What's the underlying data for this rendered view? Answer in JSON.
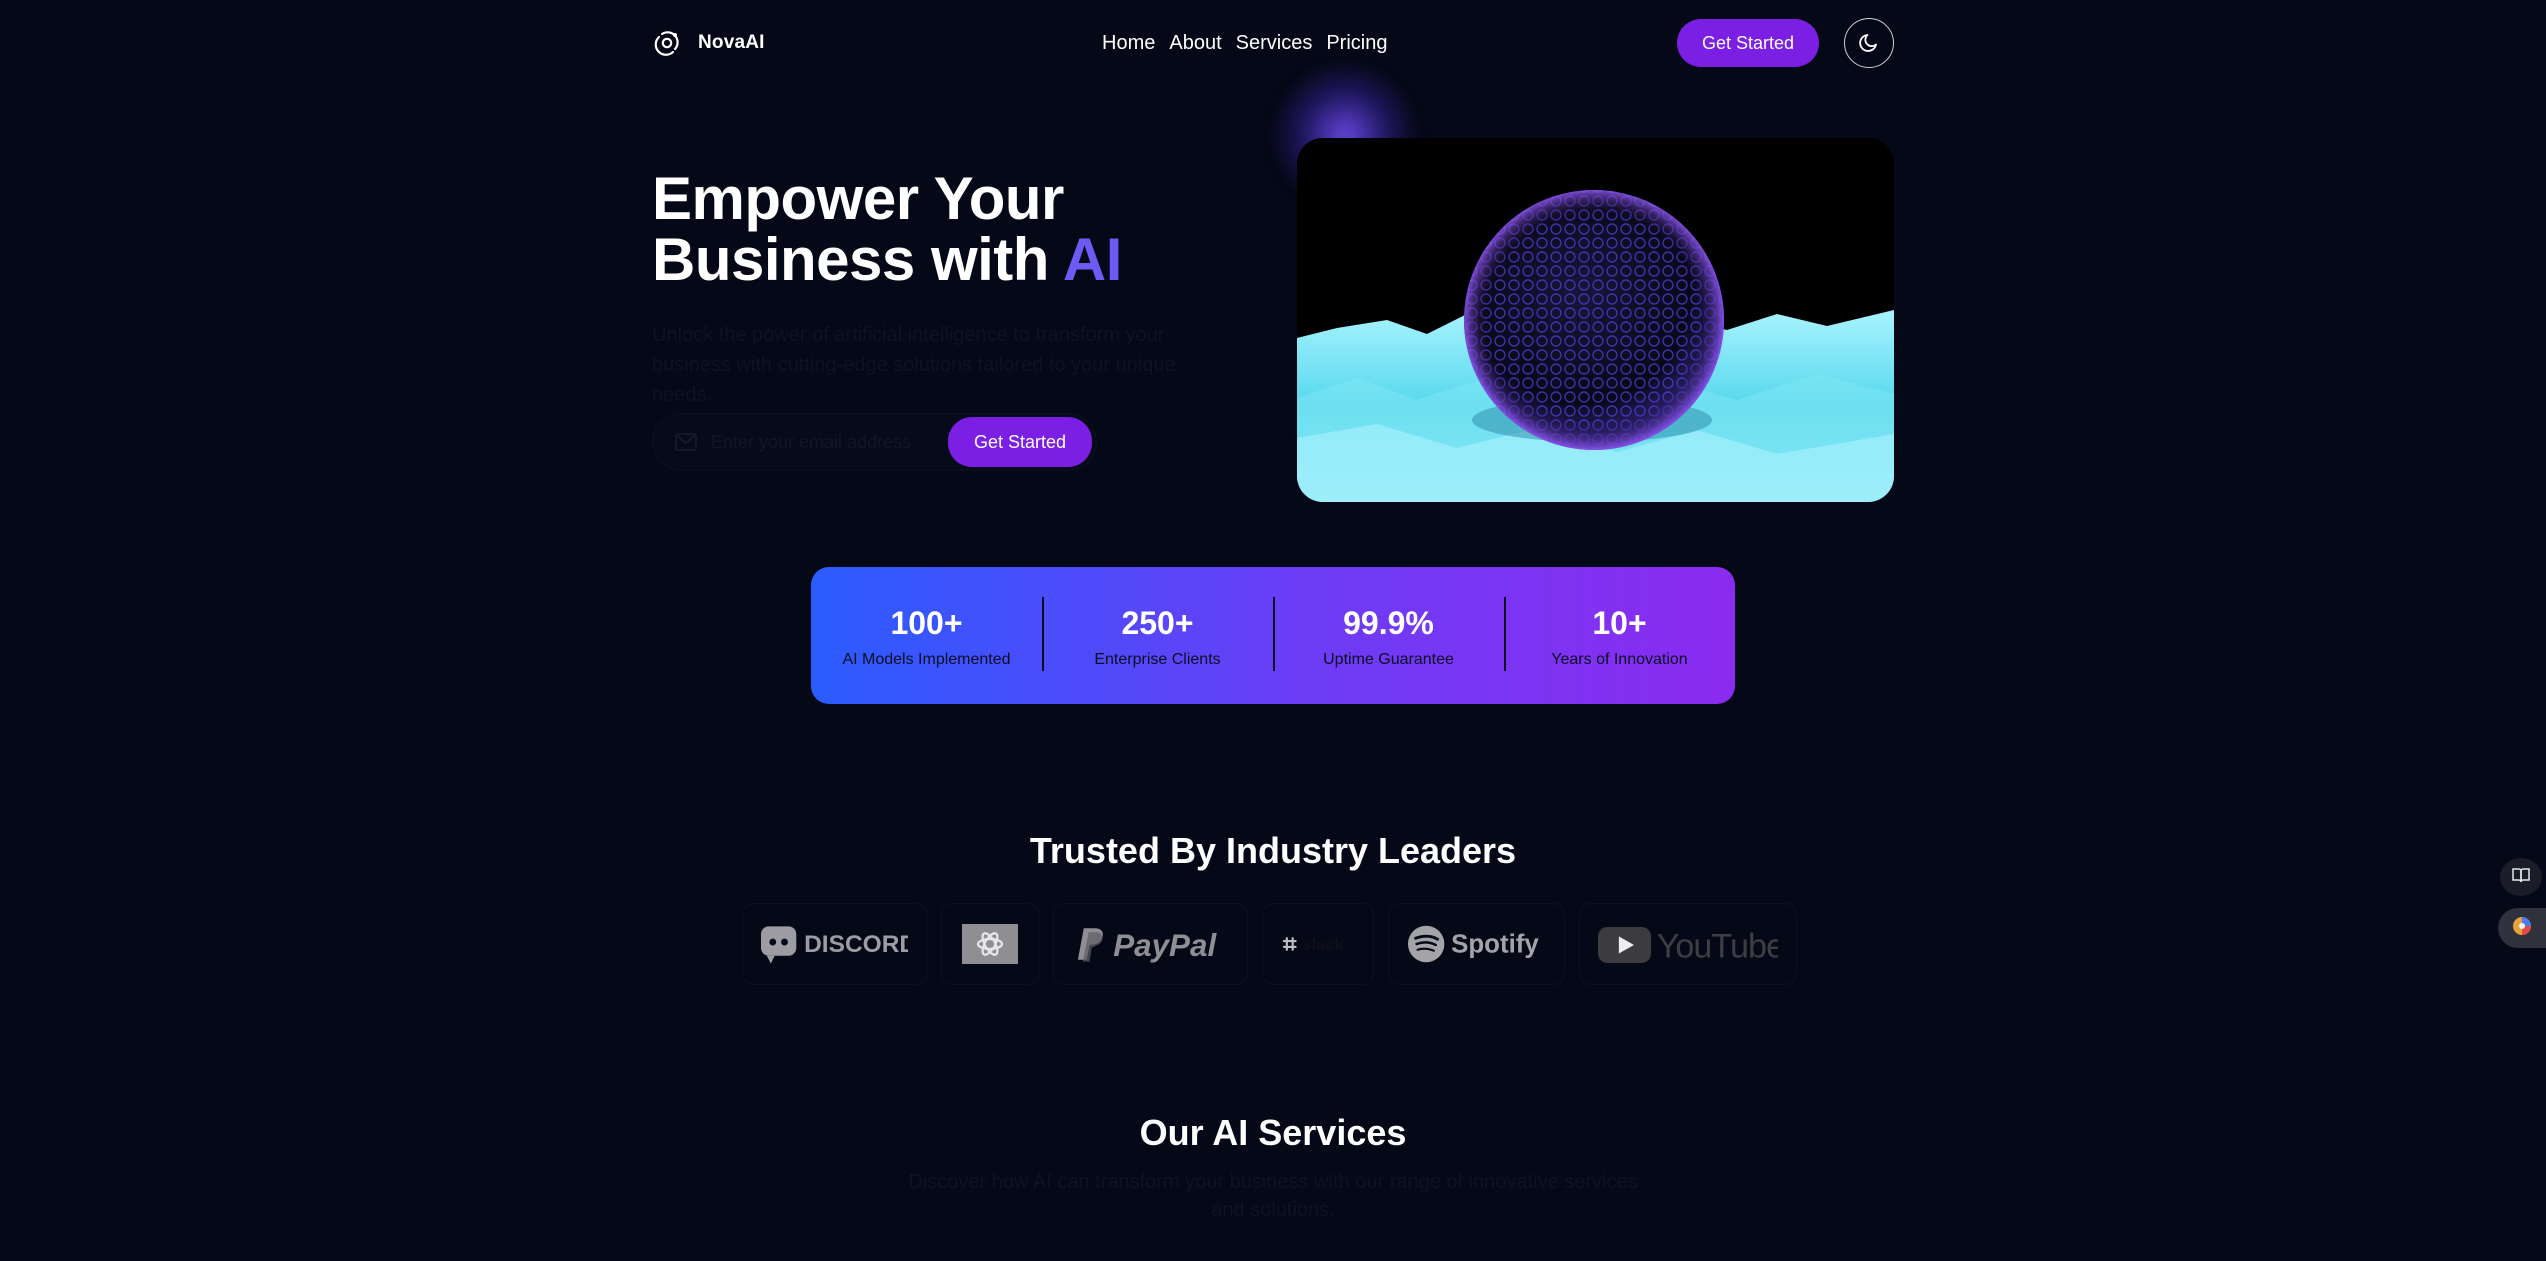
{
  "nav": {
    "brand": "NovaAI",
    "links": [
      "Home",
      "About",
      "Services",
      "Pricing"
    ],
    "cta": "Get Started",
    "theme_icon": "moon-icon"
  },
  "hero": {
    "title_line1": "Empower Your",
    "title_line2": "Business with",
    "title_accent": "AI",
    "description": "Unlock the power of artificial intelligence to transform your business with cutting-edge solutions tailored to your unique needs.",
    "email_placeholder": "Enter your email address",
    "form_button": "Get Started",
    "image_alt": "Dark spherical 3D structure over glowing cyan landscape"
  },
  "stats": [
    {
      "value": "100+",
      "label": "AI Models Implemented"
    },
    {
      "value": "250+",
      "label": "Enterprise Clients"
    },
    {
      "value": "99.9%",
      "label": "Uptime Guarantee"
    },
    {
      "value": "10+",
      "label": "Years of Innovation"
    }
  ],
  "trusted": {
    "title": "Trusted By Industry Leaders",
    "logos": [
      "DISCORD",
      "OpenAI",
      "PayPal",
      "slack",
      "Spotify",
      "YouTube"
    ]
  },
  "services": {
    "title": "Our AI Services",
    "description": "Discover how AI can transform your business with our range of innovative services and solutions."
  },
  "colors": {
    "background": "#050816",
    "accent": "#7b1fe4",
    "title_accent": "#6d5af3",
    "stats_gradient_start": "#2a5cff",
    "stats_gradient_end": "#8a2bf0"
  }
}
